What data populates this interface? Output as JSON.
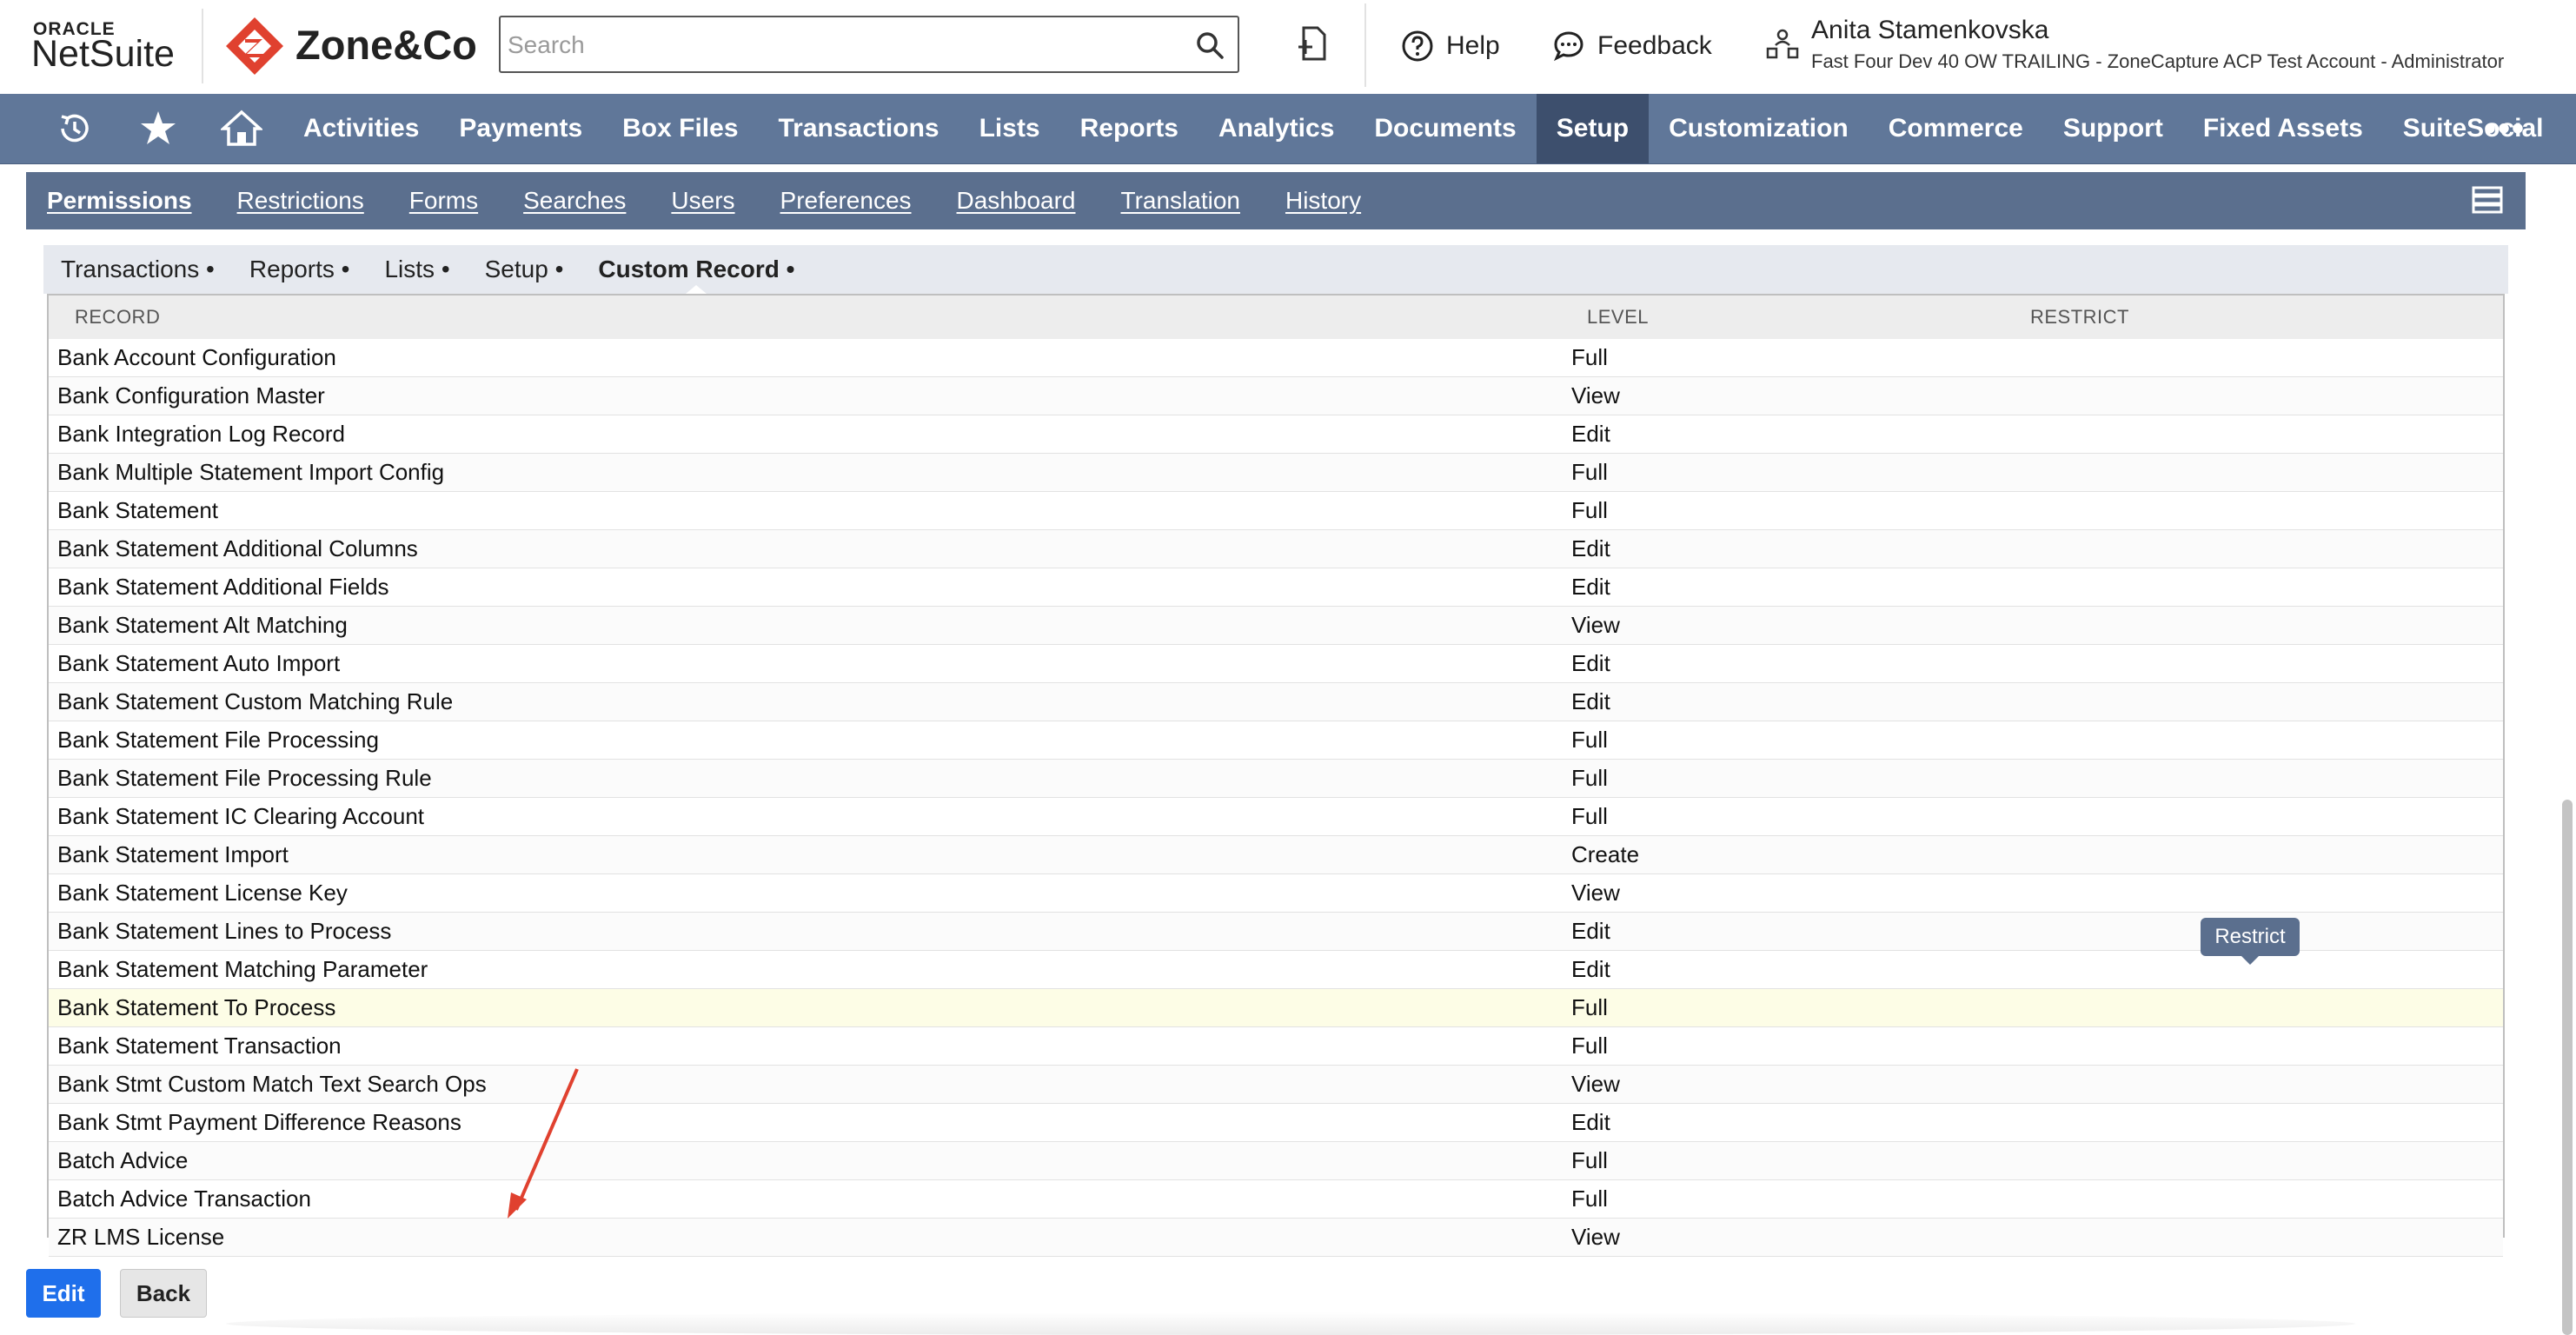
{
  "header": {
    "oracle_label": "ORACLE",
    "netsuite_label": "NetSuite",
    "brand_text": "Zone&Co",
    "brand_color": "#e0412f",
    "search_placeholder": "Search",
    "help_label": "Help",
    "feedback_label": "Feedback",
    "user_name": "Anita Stamenkovska",
    "user_role": "Fast Four Dev 40 OW TRAILING - ZoneCapture ACP Test Account  -  Administrator"
  },
  "mainnav": {
    "color": "#607799",
    "active_color": "#3d4f6d",
    "items": [
      {
        "label": "Activities"
      },
      {
        "label": "Payments"
      },
      {
        "label": "Box Files"
      },
      {
        "label": "Transactions"
      },
      {
        "label": "Lists"
      },
      {
        "label": "Reports"
      },
      {
        "label": "Analytics"
      },
      {
        "label": "Documents"
      },
      {
        "label": "Setup",
        "active": true
      },
      {
        "label": "Customization"
      },
      {
        "label": "Commerce"
      },
      {
        "label": "Support"
      },
      {
        "label": "Fixed Assets"
      },
      {
        "label": "SuiteSocial"
      }
    ],
    "more_label": "•••"
  },
  "subnav": {
    "items": [
      {
        "label": "Permissions",
        "active": true
      },
      {
        "label": "Restrictions"
      },
      {
        "label": "Forms"
      },
      {
        "label": "Searches"
      },
      {
        "label": "Users"
      },
      {
        "label": "Preferences"
      },
      {
        "label": "Dashboard"
      },
      {
        "label": "Translation"
      },
      {
        "label": "History"
      }
    ]
  },
  "tabs": [
    {
      "label": "Transactions •"
    },
    {
      "label": "Reports •"
    },
    {
      "label": "Lists •"
    },
    {
      "label": "Setup •"
    },
    {
      "label": "Custom Record •",
      "active": true
    }
  ],
  "table": {
    "columns": {
      "record": "RECORD",
      "level": "LEVEL",
      "restrict": "RESTRICT"
    },
    "rows": [
      {
        "record": "Bank Account Configuration",
        "level": "Full"
      },
      {
        "record": "Bank Configuration Master",
        "level": "View"
      },
      {
        "record": "Bank Integration Log Record",
        "level": "Edit"
      },
      {
        "record": "Bank Multiple Statement Import Config",
        "level": "Full"
      },
      {
        "record": "Bank Statement",
        "level": "Full"
      },
      {
        "record": "Bank Statement Additional Columns",
        "level": "Edit"
      },
      {
        "record": "Bank Statement Additional Fields",
        "level": "Edit"
      },
      {
        "record": "Bank Statement Alt Matching",
        "level": "View"
      },
      {
        "record": "Bank Statement Auto Import",
        "level": "Edit"
      },
      {
        "record": "Bank Statement Custom Matching Rule",
        "level": "Edit"
      },
      {
        "record": "Bank Statement File Processing",
        "level": "Full"
      },
      {
        "record": "Bank Statement File Processing Rule",
        "level": "Full"
      },
      {
        "record": "Bank Statement IC Clearing Account",
        "level": "Full"
      },
      {
        "record": "Bank Statement Import",
        "level": "Create"
      },
      {
        "record": "Bank Statement License Key",
        "level": "View"
      },
      {
        "record": "Bank Statement Lines to Process",
        "level": "Edit"
      },
      {
        "record": "Bank Statement Matching Parameter",
        "level": "Edit"
      },
      {
        "record": "Bank Statement To Process",
        "level": "Full",
        "highlight": true
      },
      {
        "record": "Bank Statement Transaction",
        "level": "Full"
      },
      {
        "record": "Bank Stmt Custom Match Text Search Ops",
        "level": "View"
      },
      {
        "record": "Bank Stmt Payment Difference Reasons",
        "level": "Edit"
      },
      {
        "record": "Batch Advice",
        "level": "Full"
      },
      {
        "record": "Batch Advice Transaction",
        "level": "Full"
      },
      {
        "record": "ZR LMS License",
        "level": "View"
      }
    ]
  },
  "tooltip": {
    "label": "Restrict"
  },
  "annotation": {
    "arrow_color": "#e0412f"
  },
  "buttons": {
    "edit_label": "Edit",
    "back_label": "Back",
    "edit_color": "#1f6feb"
  }
}
